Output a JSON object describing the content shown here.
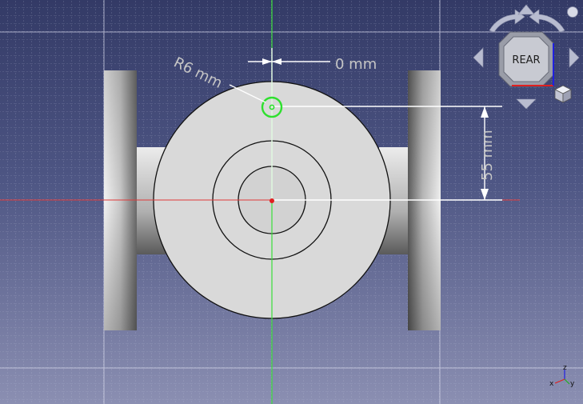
{
  "viewport": {
    "background_top": "#333a66",
    "background_bottom": "#8b8fb2",
    "grid_color": "#c8cbe0",
    "x_axis_color": "#e03a3a",
    "y_axis_color": "#3ade3a"
  },
  "sketch": {
    "radius_dimension": "R6 mm",
    "horizontal_dimension": "0 mm",
    "vertical_dimension": "55 mm",
    "selected_circle_color": "#2ee02e"
  },
  "navigation_cube": {
    "face_label": "REAR",
    "icons": [
      "rotate-left-arrow-icon",
      "rotate-right-arrow-icon",
      "arrow-up-icon",
      "arrow-down-icon",
      "arrow-left-icon",
      "arrow-right-icon",
      "menu-dot-icon",
      "view-menu-cube-icon"
    ]
  },
  "axis_indicator": {
    "z_label": "z",
    "x_label": "x",
    "y_label": "y",
    "x_color": "#e02020",
    "y_color": "#20b020",
    "z_color": "#2020e0"
  }
}
